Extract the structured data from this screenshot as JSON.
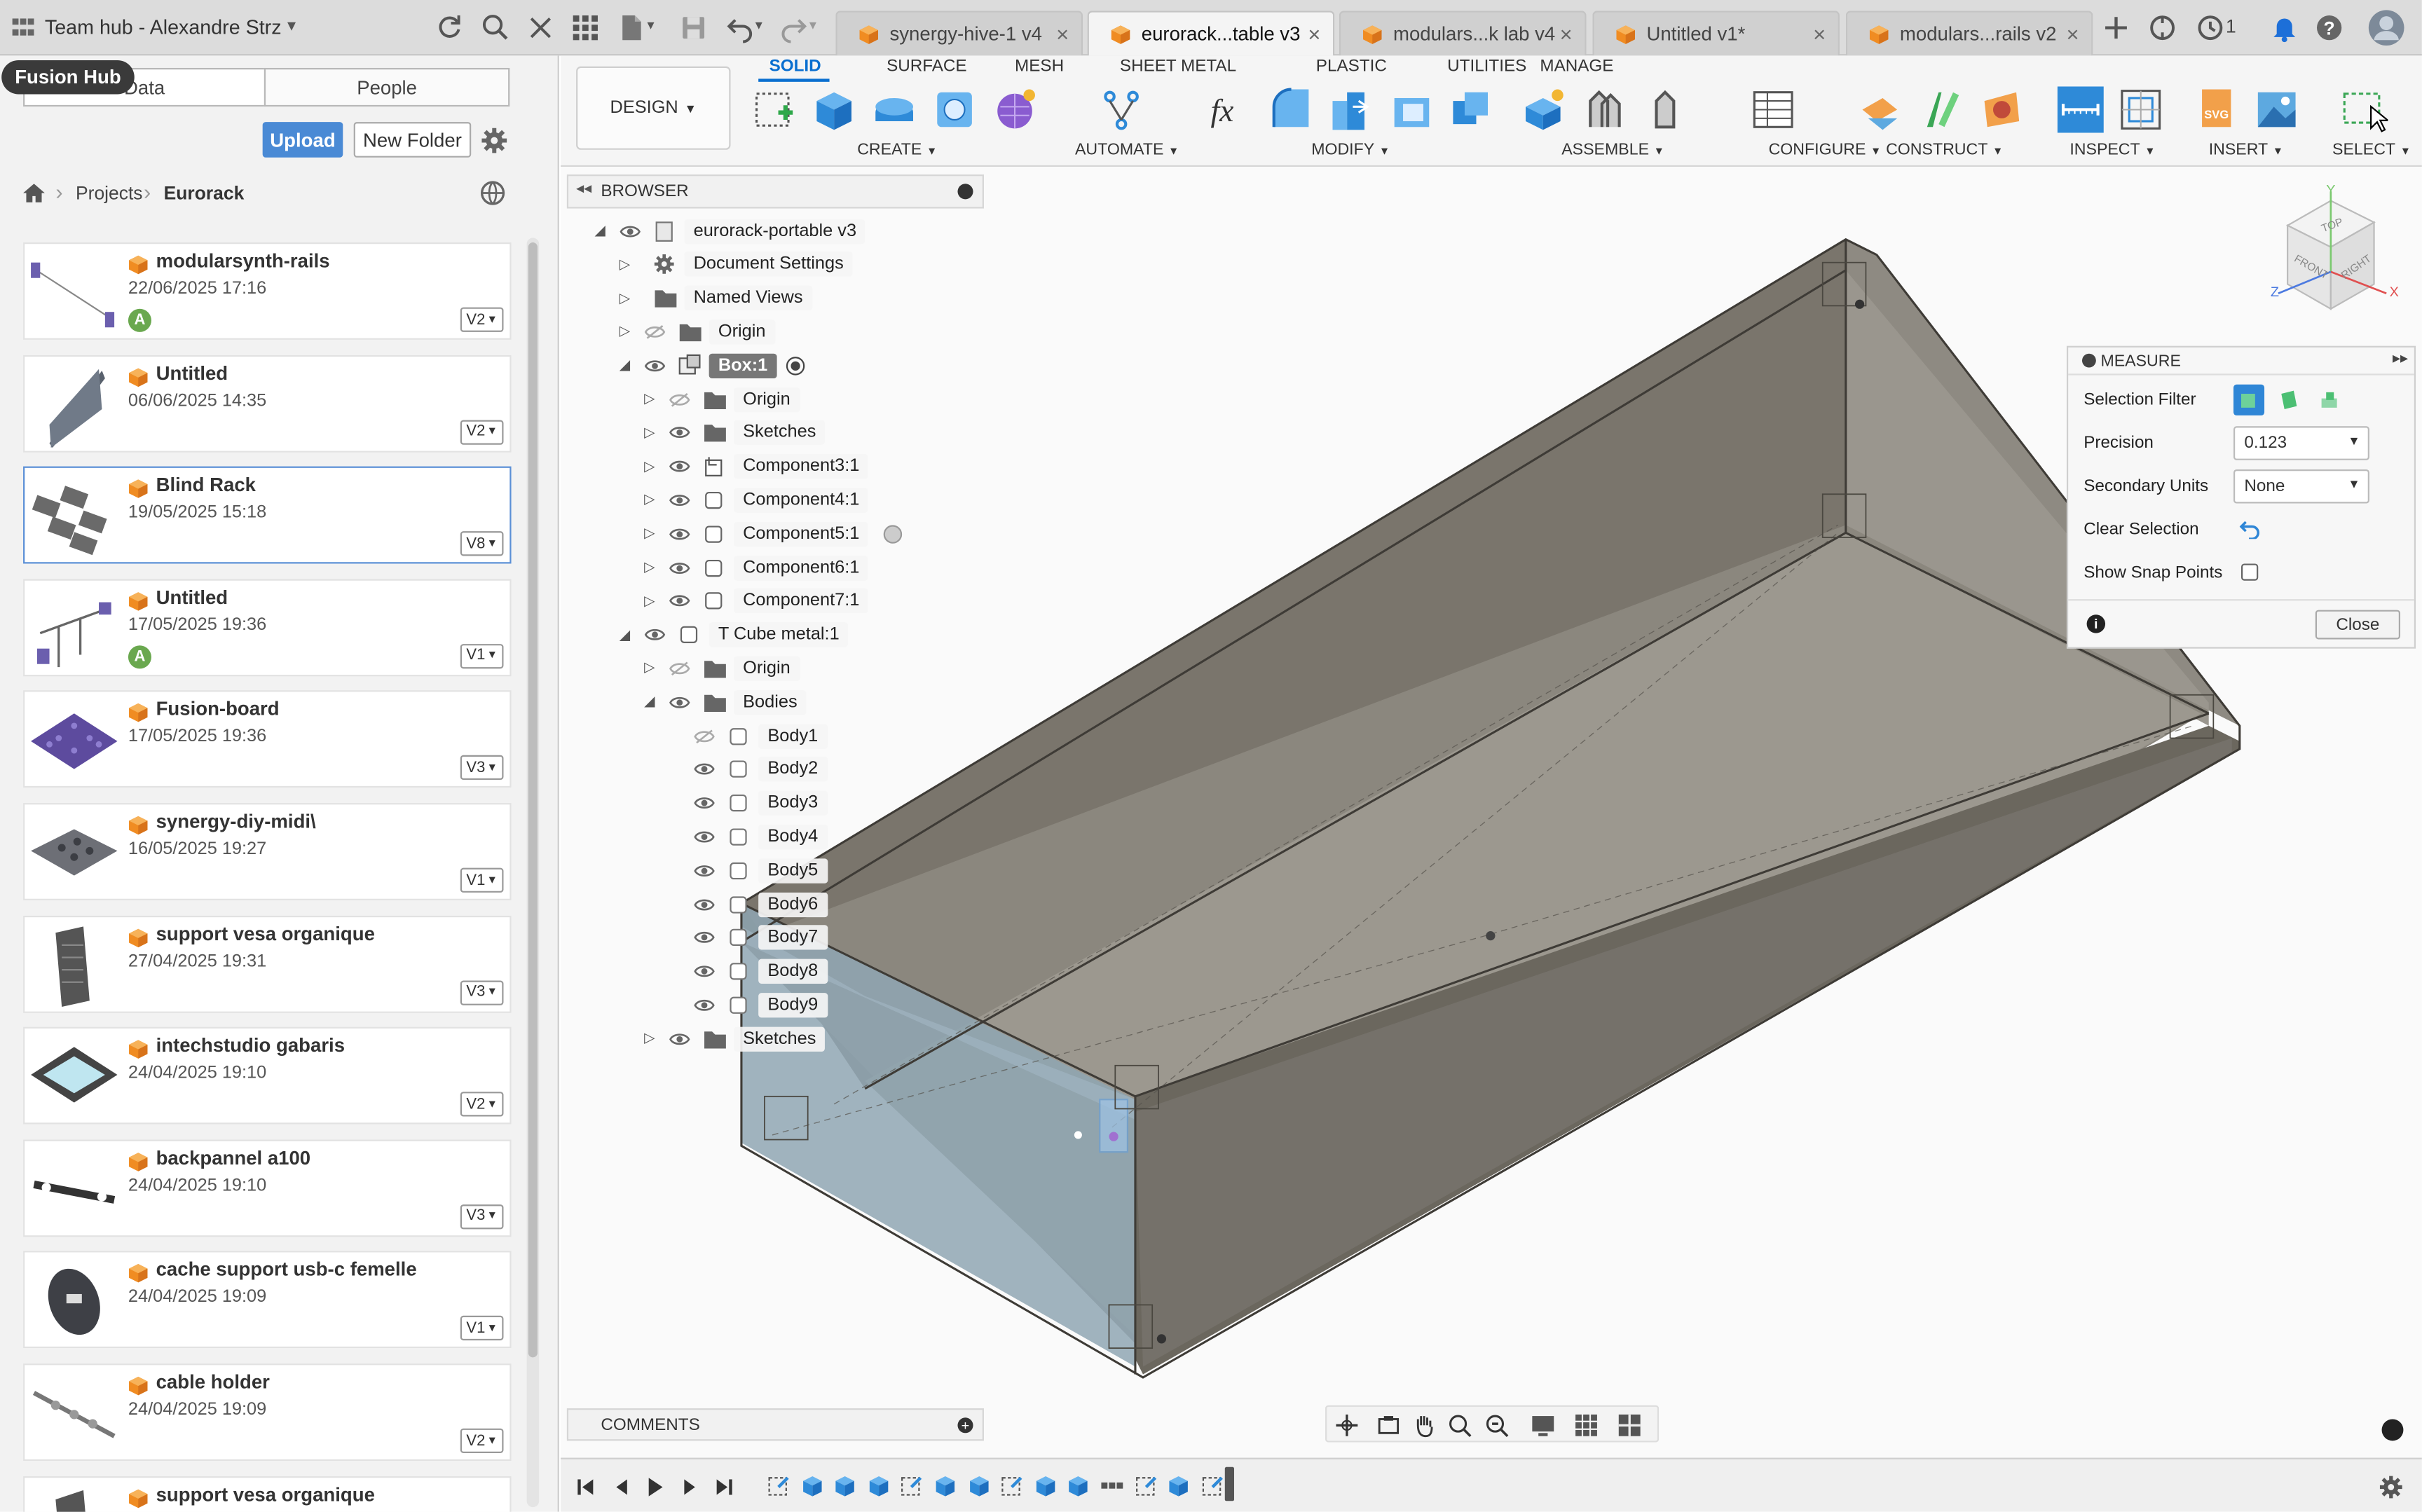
{
  "app": {
    "team_hub": "Team hub - Alexandre Strz",
    "tooltip": "Fusion Hub"
  },
  "tabs": [
    {
      "label": "synergy-hive-1 v4"
    },
    {
      "label": "eurorack...table v3"
    },
    {
      "label": "modulars...k lab v4"
    },
    {
      "label": "Untitled v1*"
    },
    {
      "label": "modulars...rails v2"
    }
  ],
  "top_right": {
    "jobs_count": "1"
  },
  "left_panel": {
    "seg_data": "Data",
    "seg_people": "People",
    "upload": "Upload",
    "new_folder": "New Folder",
    "breadcrumb": [
      "Projects",
      "Eurorack"
    ],
    "files": [
      {
        "name": "modularsynth-rails",
        "date": "22/06/2025 17:16",
        "version": "V2",
        "avatar": "A"
      },
      {
        "name": "Untitled",
        "date": "06/06/2025 14:35",
        "version": "V2",
        "avatar": ""
      },
      {
        "name": "Blind Rack",
        "date": "19/05/2025 15:18",
        "version": "V8",
        "avatar": ""
      },
      {
        "name": "Untitled",
        "date": "17/05/2025 19:36",
        "version": "V1",
        "avatar": "A"
      },
      {
        "name": "Fusion-board",
        "date": "17/05/2025 19:36",
        "version": "V3",
        "avatar": ""
      },
      {
        "name": "synergy-diy-midi\\",
        "date": "16/05/2025 19:27",
        "version": "V1",
        "avatar": ""
      },
      {
        "name": "support vesa organique",
        "date": "27/04/2025 19:31",
        "version": "V3",
        "avatar": ""
      },
      {
        "name": "intechstudio gabaris",
        "date": "24/04/2025 19:10",
        "version": "V2",
        "avatar": ""
      },
      {
        "name": "backpannel a100",
        "date": "24/04/2025 19:10",
        "version": "V3",
        "avatar": ""
      },
      {
        "name": "cache support usb-c femelle",
        "date": "24/04/2025 19:09",
        "version": "V1",
        "avatar": ""
      },
      {
        "name": "cable holder",
        "date": "24/04/2025 19:09",
        "version": "V2",
        "avatar": ""
      },
      {
        "name": "support vesa organique",
        "date": "",
        "version": "",
        "avatar": ""
      }
    ]
  },
  "toolbar": {
    "workspace": "DESIGN",
    "tabs": [
      "SOLID",
      "SURFACE",
      "MESH",
      "SHEET METAL",
      "PLASTIC",
      "UTILITIES",
      "MANAGE"
    ],
    "groups": [
      "CREATE",
      "AUTOMATE",
      "MODIFY",
      "ASSEMBLE",
      "CONFIGURE",
      "CONSTRUCT",
      "INSPECT",
      "INSERT",
      "SELECT"
    ]
  },
  "browser": {
    "title": "BROWSER",
    "nodes": [
      {
        "label": "eurorack-portable v3"
      },
      {
        "label": "Document Settings"
      },
      {
        "label": "Named Views"
      },
      {
        "label": "Origin"
      },
      {
        "label": "Box:1"
      },
      {
        "label": "Origin"
      },
      {
        "label": "Sketches"
      },
      {
        "label": "Component3:1"
      },
      {
        "label": "Component4:1"
      },
      {
        "label": "Component5:1"
      },
      {
        "label": "Component6:1"
      },
      {
        "label": "Component7:1"
      },
      {
        "label": "T Cube metal:1"
      },
      {
        "label": "Origin"
      },
      {
        "label": "Bodies"
      },
      {
        "label": "Body1"
      },
      {
        "label": "Body2"
      },
      {
        "label": "Body3"
      },
      {
        "label": "Body4"
      },
      {
        "label": "Body5"
      },
      {
        "label": "Body6"
      },
      {
        "label": "Body7"
      },
      {
        "label": "Body8"
      },
      {
        "label": "Body9"
      },
      {
        "label": "Sketches"
      }
    ]
  },
  "measure": {
    "title": "MEASURE",
    "selection_filter": "Selection Filter",
    "precision_label": "Precision",
    "precision_value": "0.123",
    "secondary_units_label": "Secondary Units",
    "secondary_units_value": "None",
    "clear_selection": "Clear Selection",
    "show_snap_points": "Show Snap Points",
    "close": "Close"
  },
  "viewcube": {
    "top": "TOP",
    "front": "FRONT",
    "right": "RIGHT",
    "x": "X",
    "y": "Y",
    "z": "Z"
  },
  "comments": {
    "title": "COMMENTS"
  }
}
